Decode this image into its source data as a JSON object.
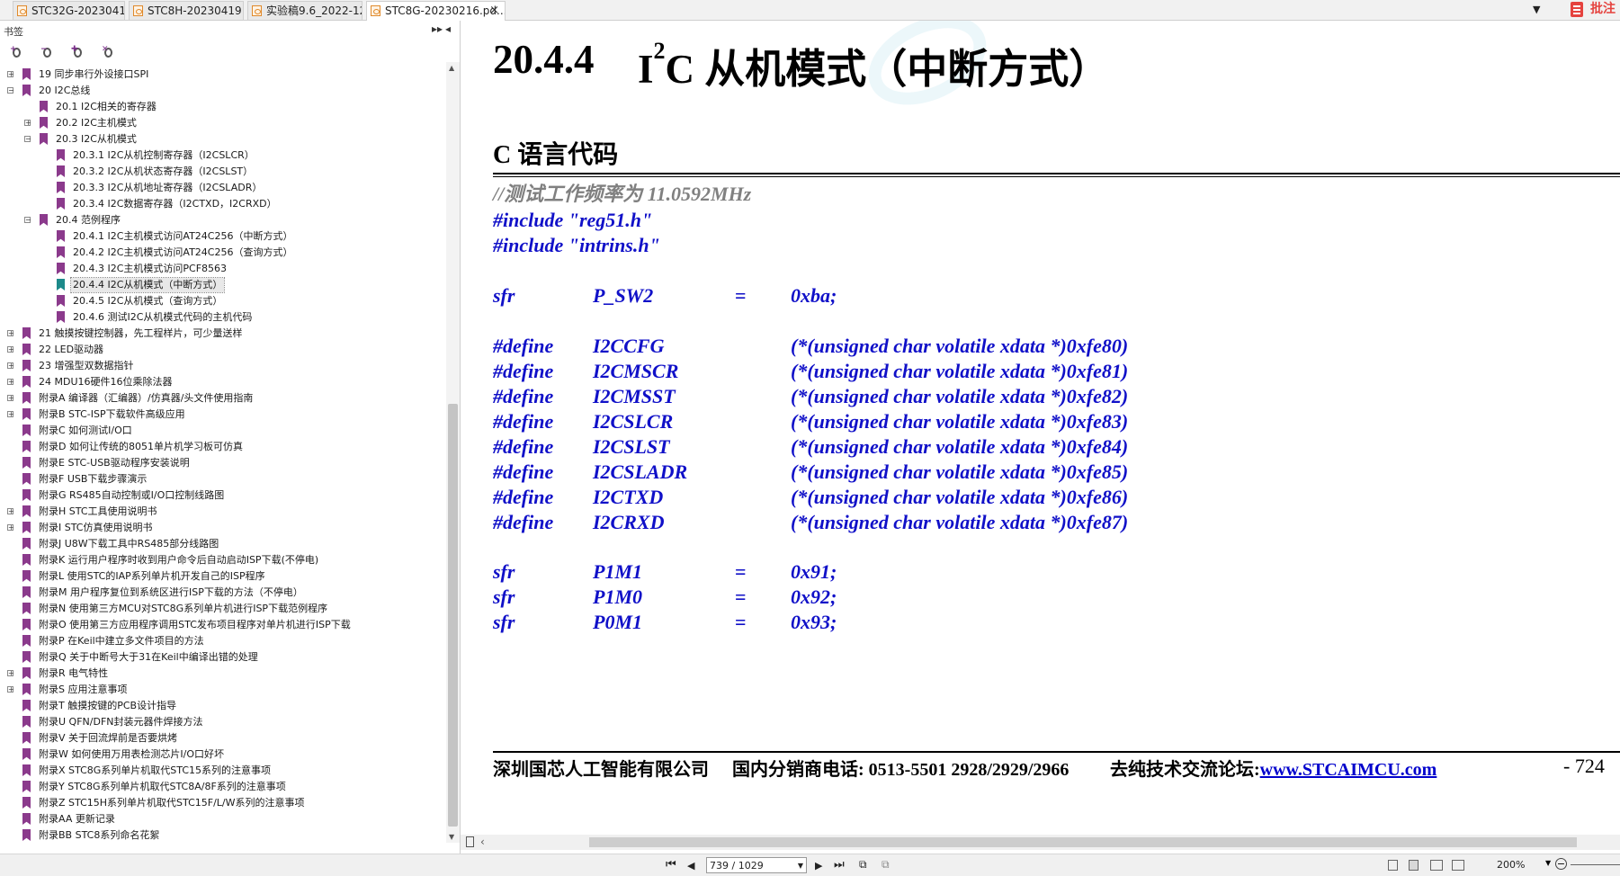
{
  "tabs": [
    {
      "label": "STC32G-20230419....",
      "active": false
    },
    {
      "label": "STC8H-20230419.p...",
      "active": false
    },
    {
      "label": "实验稿9.6_2022-12-...",
      "active": false
    },
    {
      "label": "STC8G-20230216.pd...",
      "active": true,
      "close": "×"
    }
  ],
  "annotation_label": "批注",
  "panel": {
    "title": "书签",
    "btn_expand": "▸▸",
    "btn_collapse": "◂"
  },
  "bookmarks": [
    {
      "label": "19 同步串行外设接口SPI",
      "level": 0,
      "toggle": "+"
    },
    {
      "label": "20 I2C总线",
      "level": 0,
      "toggle": "−"
    },
    {
      "label": "20.1 I2C相关的寄存器",
      "level": 1,
      "toggle": ""
    },
    {
      "label": "20.2 I2C主机模式",
      "level": 1,
      "toggle": "+"
    },
    {
      "label": "20.3 I2C从机模式",
      "level": 1,
      "toggle": "−"
    },
    {
      "label": "20.3.1 I2C从机控制寄存器（I2CSLCR）",
      "level": 2,
      "toggle": ""
    },
    {
      "label": "20.3.2 I2C从机状态寄存器（I2CSLST）",
      "level": 2,
      "toggle": ""
    },
    {
      "label": "20.3.3 I2C从机地址寄存器（I2CSLADR）",
      "level": 2,
      "toggle": ""
    },
    {
      "label": "20.3.4 I2C数据寄存器（I2CTXD，I2CRXD）",
      "level": 2,
      "toggle": ""
    },
    {
      "label": "20.4 范例程序",
      "level": 1,
      "toggle": "−"
    },
    {
      "label": "20.4.1 I2C主机模式访问AT24C256（中断方式）",
      "level": 2,
      "toggle": ""
    },
    {
      "label": "20.4.2 I2C主机模式访问AT24C256（查询方式）",
      "level": 2,
      "toggle": ""
    },
    {
      "label": "20.4.3 I2C主机模式访问PCF8563",
      "level": 2,
      "toggle": ""
    },
    {
      "label": "20.4.4 I2C从机模式（中断方式）",
      "level": 2,
      "toggle": "",
      "selected": true
    },
    {
      "label": "20.4.5 I2C从机模式（查询方式）",
      "level": 2,
      "toggle": ""
    },
    {
      "label": "20.4.6 测试I2C从机模式代码的主机代码",
      "level": 2,
      "toggle": ""
    },
    {
      "label": "21 触摸按键控制器，先工程样片，可少量送样",
      "level": 0,
      "toggle": "+"
    },
    {
      "label": "22 LED驱动器",
      "level": 0,
      "toggle": "+"
    },
    {
      "label": "23 增强型双数据指针",
      "level": 0,
      "toggle": "+"
    },
    {
      "label": "24 MDU16硬件16位乘除法器",
      "level": 0,
      "toggle": "+"
    },
    {
      "label": "附录A 编译器（汇编器）/仿真器/头文件使用指南",
      "level": 0,
      "toggle": "+"
    },
    {
      "label": "附录B STC-ISP下载软件高级应用",
      "level": 0,
      "toggle": "+"
    },
    {
      "label": "附录C 如何测试I/O口",
      "level": 0,
      "toggle": ""
    },
    {
      "label": "附录D 如何让传统的8051单片机学习板可仿真",
      "level": 0,
      "toggle": ""
    },
    {
      "label": "附录E STC-USB驱动程序安装说明",
      "level": 0,
      "toggle": ""
    },
    {
      "label": "附录F USB下载步骤演示",
      "level": 0,
      "toggle": ""
    },
    {
      "label": "附录G RS485自动控制或I/O口控制线路图",
      "level": 0,
      "toggle": ""
    },
    {
      "label": "附录H STC工具使用说明书",
      "level": 0,
      "toggle": "+"
    },
    {
      "label": "附录I STC仿真使用说明书",
      "level": 0,
      "toggle": "+"
    },
    {
      "label": "附录J U8W下载工具中RS485部分线路图",
      "level": 0,
      "toggle": ""
    },
    {
      "label": "附录K 运行用户程序时收到用户命令后自动启动ISP下载(不停电)",
      "level": 0,
      "toggle": ""
    },
    {
      "label": "附录L 使用STC的IAP系列单片机开发自己的ISP程序",
      "level": 0,
      "toggle": ""
    },
    {
      "label": "附录M 用户程序复位到系统区进行ISP下载的方法（不停电）",
      "level": 0,
      "toggle": ""
    },
    {
      "label": "附录N 使用第三方MCU对STC8G系列单片机进行ISP下载范例程序",
      "level": 0,
      "toggle": ""
    },
    {
      "label": "附录O 使用第三方应用程序调用STC发布项目程序对单片机进行ISP下载",
      "level": 0,
      "toggle": ""
    },
    {
      "label": "附录P 在Keil中建立多文件项目的方法",
      "level": 0,
      "toggle": ""
    },
    {
      "label": "附录Q 关于中断号大于31在Keil中编译出错的处理",
      "level": 0,
      "toggle": ""
    },
    {
      "label": "附录R 电气特性",
      "level": 0,
      "toggle": "+"
    },
    {
      "label": "附录S 应用注意事项",
      "level": 0,
      "toggle": "+"
    },
    {
      "label": "附录T 触摸按键的PCB设计指导",
      "level": 0,
      "toggle": ""
    },
    {
      "label": "附录U QFN/DFN封装元器件焊接方法",
      "level": 0,
      "toggle": ""
    },
    {
      "label": "附录V 关于回流焊前是否要烘烤",
      "level": 0,
      "toggle": ""
    },
    {
      "label": "附录W 如何使用万用表检测芯片I/O口好坏",
      "level": 0,
      "toggle": ""
    },
    {
      "label": "附录X STC8G系列单片机取代STC15系列的注意事项",
      "level": 0,
      "toggle": ""
    },
    {
      "label": "附录Y STC8G系列单片机取代STC8A/8F系列的注意事项",
      "level": 0,
      "toggle": ""
    },
    {
      "label": "附录Z STC15H系列单片机取代STC15F/L/W系列的注意事项",
      "level": 0,
      "toggle": ""
    },
    {
      "label": "附录AA 更新记录",
      "level": 0,
      "toggle": ""
    },
    {
      "label": "附录BB STC8系列命名花絮",
      "level": 0,
      "toggle": ""
    }
  ],
  "document": {
    "section_number": "20.4.4",
    "title_prefix": "I",
    "title_sup": "2",
    "title_rest": "C 从机模式（中断方式）",
    "subheading": "C 语言代码",
    "comment": "//测试工作频率为 11.0592MHz",
    "includes": [
      "#include \"reg51.h\"",
      "#include \"intrins.h\""
    ],
    "sfr_p_sw2": {
      "kw": "sfr",
      "name": "P_SW2",
      "eq": "=",
      "val": "0xba;"
    },
    "defines": [
      {
        "kw": "#define",
        "name": "I2CCFG",
        "val": "(*(unsigned char volatile xdata *)0xfe80)"
      },
      {
        "kw": "#define",
        "name": "I2CMSCR",
        "val": "(*(unsigned char volatile xdata *)0xfe81)"
      },
      {
        "kw": "#define",
        "name": "I2CMSST",
        "val": "(*(unsigned char volatile xdata *)0xfe82)"
      },
      {
        "kw": "#define",
        "name": "I2CSLCR",
        "val": "(*(unsigned char volatile xdata *)0xfe83)"
      },
      {
        "kw": "#define",
        "name": "I2CSLST",
        "val": "(*(unsigned char volatile xdata *)0xfe84)"
      },
      {
        "kw": "#define",
        "name": "I2CSLADR",
        "val": "(*(unsigned char volatile xdata *)0xfe85)"
      },
      {
        "kw": "#define",
        "name": "I2CTXD",
        "val": "(*(unsigned char volatile xdata *)0xfe86)"
      },
      {
        "kw": "#define",
        "name": "I2CRXD",
        "val": "(*(unsigned char volatile xdata *)0xfe87)"
      }
    ],
    "sfrs": [
      {
        "kw": "sfr",
        "name": "P1M1",
        "eq": "=",
        "val": "0x91;"
      },
      {
        "kw": "sfr",
        "name": "P1M0",
        "eq": "=",
        "val": "0x92;"
      },
      {
        "kw": "sfr",
        "name": "P0M1",
        "eq": "=",
        "val": "0x93;"
      }
    ],
    "footer": {
      "company": "深圳国芯人工智能有限公司",
      "phone": "国内分销商电话: 0513-5501 2928/2929/2966",
      "forum_label": "去纯技术交流论坛:",
      "forum_url": "www.STCAIMCU.com",
      "page_number": "- 724"
    }
  },
  "statusbar": {
    "first": "⏮",
    "prev": "◀",
    "page_field": "739 / 1029",
    "next": "▶",
    "last": "⏭",
    "zoom": "200%"
  }
}
